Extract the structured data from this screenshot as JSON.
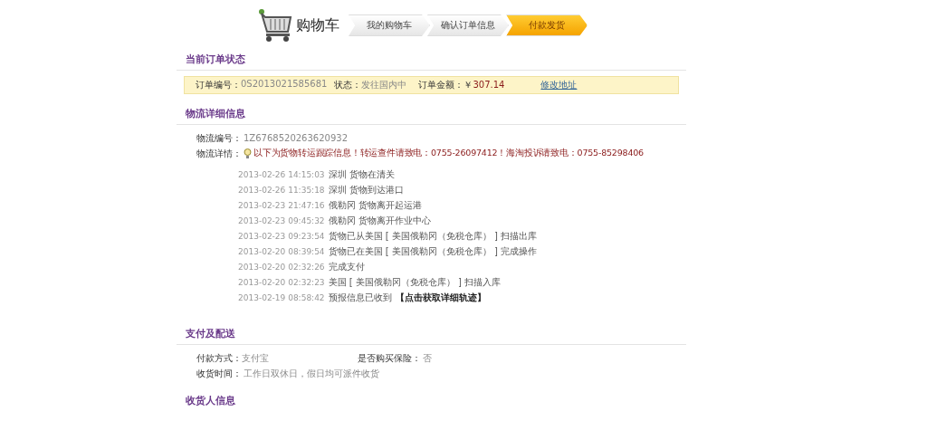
{
  "header": {
    "logo_text": "购物车",
    "steps": [
      {
        "label": "我的购物车",
        "selected": false
      },
      {
        "label": "确认订单信息",
        "selected": false
      },
      {
        "label": "付款发货",
        "selected": true
      }
    ]
  },
  "order_status": {
    "title": "当前订单状态",
    "fields": [
      {
        "label": "订单编号：",
        "value": "0S2013021585681",
        "kind": "plain"
      },
      {
        "label": "状态：",
        "value": "发往国内中",
        "kind": "plain"
      },
      {
        "label": "订单金额：",
        "value": "307.14",
        "currency": "￥",
        "kind": "amount"
      }
    ],
    "link": "修改地址"
  },
  "logistics": {
    "title": "物流详细信息",
    "number_label": "物流编号：",
    "number": "1Z6768520263620932",
    "detail_label": "物流详情：",
    "notice": "以下为货物转运跟踪信息！转运查件请致电：0755-26097412！海淘投诉请致电：0755-85298406",
    "events": [
      {
        "time": "2013-02-26 14:15:03",
        "text": "深圳 货物在清关"
      },
      {
        "time": "2013-02-26 11:35:18",
        "text": "深圳 货物到达港口"
      },
      {
        "time": "2013-02-23 21:47:16",
        "text": "俄勒冈 货物离开起运港"
      },
      {
        "time": "2013-02-23 09:45:32",
        "text": "俄勒冈 货物离开作业中心"
      },
      {
        "time": "2013-02-23 09:23:54",
        "text": "货物已从美国 [ 美国俄勒冈（免税仓库） ] 扫描出库"
      },
      {
        "time": "2013-02-20 08:39:54",
        "text": "货物已在美国 [ 美国俄勒冈（免税仓库） ] 完成操作"
      },
      {
        "time": "2013-02-20 02:32:26",
        "text": "完成支付"
      },
      {
        "time": "2013-02-20 02:32:23",
        "text": "美国 [ 美国俄勒冈（免税仓库） ] 扫描入库"
      },
      {
        "time": "2013-02-19 08:58:42",
        "text": "预报信息已收到",
        "link": "【点击获取详细轨迹】"
      }
    ]
  },
  "payment": {
    "title": "支付及配送",
    "method_label": "付款方式：",
    "method": "支付宝",
    "insurance_label": "是否购买保险：",
    "insurance": "否",
    "time_label": "收货时间：",
    "time": "工作日双休日，假日均可派件收货"
  },
  "consignee": {
    "title": "收货人信息"
  }
}
